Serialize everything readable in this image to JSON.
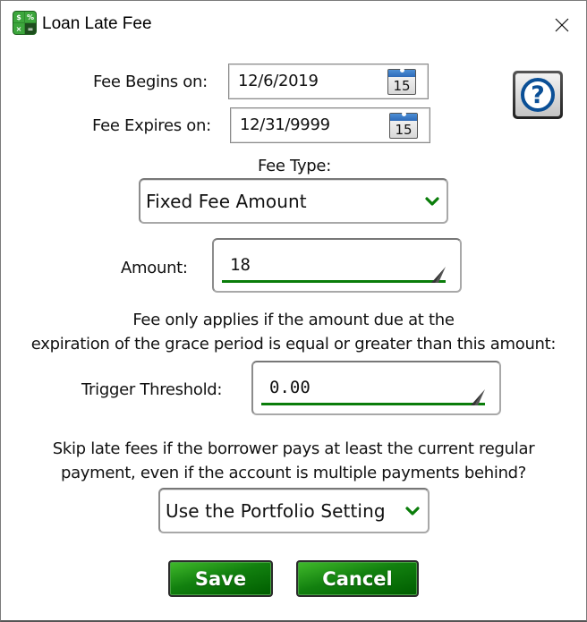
{
  "window": {
    "title": "Loan Late Fee",
    "app_icon": "calculator-icon",
    "app_icon_glyphs": [
      "$",
      "%",
      "×",
      "="
    ],
    "close_icon": "close-icon"
  },
  "fee_begins": {
    "label": "Fee Begins on:",
    "value": "12/6/2019",
    "calendar_icon_day": "15"
  },
  "fee_expires": {
    "label": "Fee Expires on:",
    "value": "12/31/9999",
    "calendar_icon_day": "15"
  },
  "help": {
    "icon": "help-icon",
    "glyph": "?"
  },
  "fee_type": {
    "label": "Fee Type:",
    "selected": "Fixed Fee Amount"
  },
  "amount": {
    "label": "Amount:",
    "value": "18"
  },
  "threshold_note": {
    "line1": "Fee only applies if the amount due at the",
    "line2": "expiration of the grace period is equal or greater than this amount:"
  },
  "trigger_threshold": {
    "label": "Trigger Threshold:",
    "value": "0.00"
  },
  "skip_question": {
    "line1": "Skip late fees if the borrower pays at least the current regular",
    "line2": "payment, even if the account is multiple payments behind?",
    "selected": "Use the Portfolio Setting"
  },
  "buttons": {
    "save": "Save",
    "cancel": "Cancel"
  },
  "colors": {
    "accent_green": "#0a7d0a",
    "help_blue": "#0a4f96"
  }
}
